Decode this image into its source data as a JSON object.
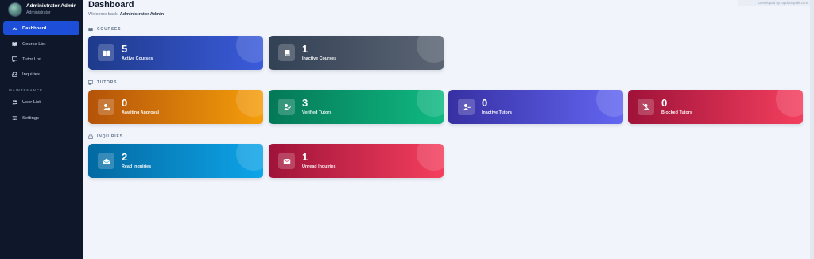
{
  "sidebar": {
    "profile": {
      "name": "Administrator Admin",
      "role": "Administrator"
    },
    "items": [
      {
        "label": "Dashboard",
        "icon": "dashboard-icon",
        "active": true
      },
      {
        "label": "Course List",
        "icon": "book-icon"
      },
      {
        "label": "Tutor List",
        "icon": "chalkboard-icon"
      },
      {
        "label": "Inquiries",
        "icon": "inbox-icon"
      }
    ],
    "section_label": "MAINTENANCE",
    "maintenance_items": [
      {
        "label": "User List",
        "icon": "users-icon"
      },
      {
        "label": "Settings",
        "icon": "sliders-icon"
      }
    ]
  },
  "header": {
    "title": "Dashboard",
    "welcome_prefix": "Welcome back, ",
    "welcome_name": "Administrator Admin",
    "developer_credit": "Developed by: updategadk.com"
  },
  "sections": {
    "courses": {
      "label": "COURSES",
      "cards": [
        {
          "value": "5",
          "label": "Active Courses",
          "icon": "open-book-icon",
          "colors": [
            "#1e3a8a",
            "#3b5bdb"
          ]
        },
        {
          "value": "1",
          "label": "Inactive Courses",
          "icon": "closed-book-icon",
          "colors": [
            "#334155",
            "#5b6473"
          ]
        }
      ]
    },
    "tutors": {
      "label": "TUTORS",
      "cards": [
        {
          "value": "0",
          "label": "Awaiting Approval",
          "icon": "user-clock-icon",
          "colors": [
            "#b45309",
            "#f59e0b"
          ]
        },
        {
          "value": "3",
          "label": "Verified Tutors",
          "icon": "user-check-icon",
          "colors": [
            "#047857",
            "#10b981"
          ]
        },
        {
          "value": "0",
          "label": "Inactive Tutors",
          "icon": "user-minus-icon",
          "colors": [
            "#3730a3",
            "#6366f1"
          ]
        },
        {
          "value": "0",
          "label": "Blocked Tutors",
          "icon": "user-slash-icon",
          "colors": [
            "#9f1239",
            "#f43f5e"
          ]
        }
      ]
    },
    "inquiries": {
      "label": "INQUIRIES",
      "cards": [
        {
          "value": "2",
          "label": "Read Inquiries",
          "icon": "envelope-open-icon",
          "colors": [
            "#0369a1",
            "#0ea5e9"
          ]
        },
        {
          "value": "1",
          "label": "Unread Inquiries",
          "icon": "envelope-icon",
          "colors": [
            "#9f1239",
            "#f43f5e"
          ]
        }
      ]
    }
  }
}
